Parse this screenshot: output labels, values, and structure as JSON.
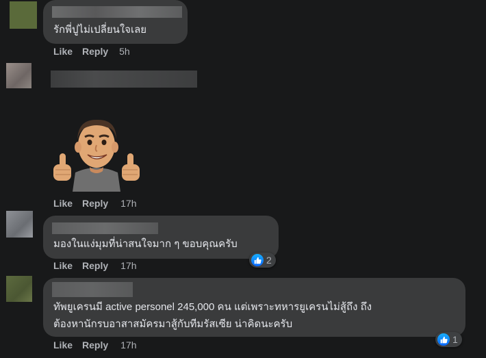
{
  "comments": [
    {
      "text": "รักพี่ปูไม่เปลี่ยนใจเลย",
      "like": "Like",
      "reply": "Reply",
      "time": "5h"
    },
    {
      "sticker": "thumbs-up-avatar-sticker",
      "like": "Like",
      "reply": "Reply",
      "time": "17h"
    },
    {
      "text": "มองในแง่มุมที่น่าสนใจมาก ๆ ขอบคุณครับ",
      "like": "Like",
      "reply": "Reply",
      "time": "17h",
      "reactions": "2"
    },
    {
      "text_line1": "ทัพยูเครนมี active personel 245,000 คน แต่เพราะทหารยูเครนไม่สู้ถึง ถึง",
      "text_line2": "ต้องหานักรบอาสาสมัครมาสู้กับทีมรัสเซีย น่าคิดนะครับ",
      "like": "Like",
      "reply": "Reply",
      "time": "17h",
      "reactions": "1"
    }
  ],
  "colors": {
    "background": "#18191a",
    "bubble": "#3a3b3c",
    "text": "#e4e6eb",
    "muted": "#b0b3b8",
    "like_blue": "#0866ff"
  },
  "icons": {
    "reaction": "like-thumb-icon"
  }
}
